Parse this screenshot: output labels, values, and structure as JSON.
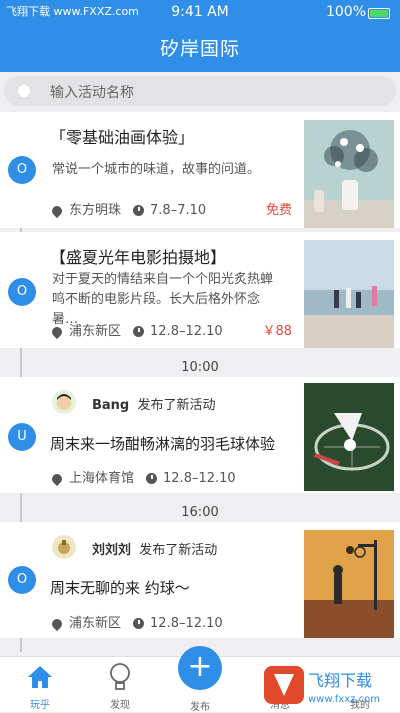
{
  "status_bar": {
    "carrier": "飞翔下载 www.FXXZ.com",
    "time": "9:41 AM",
    "battery": "100%"
  },
  "header": {
    "title": "矽岸国际"
  },
  "search": {
    "placeholder": "输入活动名称"
  },
  "cards": [
    {
      "node": "O",
      "title": "「零基础油画体验」",
      "desc": "常说一个城市的味道，故事的问道。",
      "location": "东方明珠",
      "date": "7.8–7.10",
      "price": "免费"
    },
    {
      "node": "O",
      "title": "【盛夏光年电影拍摄地】",
      "desc": "对于夏天的情结来自一个个阳光炙热蝉鸣不断的电影片段。长大后格外怀念暑…",
      "location": "浦东新区",
      "date": "12.8–12.10",
      "price": "￥88"
    },
    {
      "node": "U",
      "user": "Bang",
      "action": "发布了新活动",
      "title": "周末来一场酣畅淋漓的羽毛球体验",
      "location": "上海体育馆",
      "date": "12.8–12.10"
    },
    {
      "node": "O",
      "user": "刘刘刘",
      "action": "发布了新活动",
      "title": "周末无聊的来 约球～",
      "location": "浦东新区",
      "date": "12.8–12.10"
    }
  ],
  "separators": [
    "10:00",
    "16:00"
  ],
  "tabs": [
    {
      "label": "玩乎",
      "icon": "home-icon"
    },
    {
      "label": "发现",
      "icon": "bulb-icon"
    },
    {
      "label": "发布",
      "icon": "plus-icon"
    },
    {
      "label": "消息",
      "icon": "message-icon"
    },
    {
      "label": "我的",
      "icon": "user-icon"
    }
  ],
  "fab_symbol": "+",
  "watermark": "飞翔下载 www.fxxz.com",
  "colors": {
    "accent": "#2f8fe8",
    "price": "#e24b3a"
  }
}
